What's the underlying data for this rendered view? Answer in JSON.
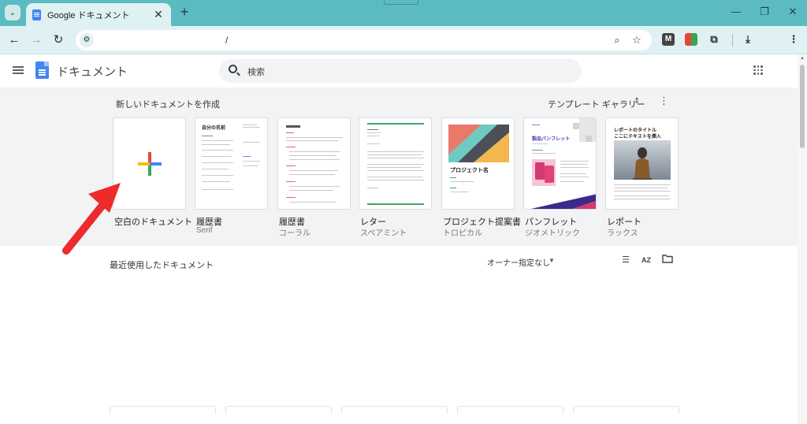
{
  "browser": {
    "tab_title": "Google ドキュメント",
    "tab_close": "✕",
    "new_tab": "+",
    "url": "/",
    "window": {
      "minimize": "—",
      "restore": "❐",
      "close": "✕"
    },
    "extensions": {
      "m": "M"
    }
  },
  "docs": {
    "app_name": "ドキュメント",
    "search_placeholder": "検索"
  },
  "gallery": {
    "title": "新しいドキュメントを作成",
    "switcher": "テンプレート ギャラリー",
    "templates": [
      {
        "name": "空白のドキュメント",
        "sub": ""
      },
      {
        "name": "履歴書",
        "sub": "Serif"
      },
      {
        "name": "履歴書",
        "sub": "コーラル"
      },
      {
        "name": "レター",
        "sub": "スペアミント"
      },
      {
        "name": "プロジェクト提案書",
        "sub": "トロピカル"
      },
      {
        "name": "パンフレット",
        "sub": "ジオメトリック"
      },
      {
        "name": "レポート",
        "sub": "ラックス"
      }
    ],
    "thumb_text": {
      "resume_title": "自分の名前",
      "project_title": "プロジェクト名",
      "brochure_title": "製品パンフレット",
      "report_title": "レポートのタイトル",
      "report_subtitle": "ここにテキストを挿入"
    }
  },
  "recent": {
    "title": "最近使用したドキュメント",
    "owner_filter": "オーナー指定なし"
  },
  "colors": {
    "chrome_teal": "#5bbbc1",
    "annotation_arrow": "#ee2a2a"
  }
}
